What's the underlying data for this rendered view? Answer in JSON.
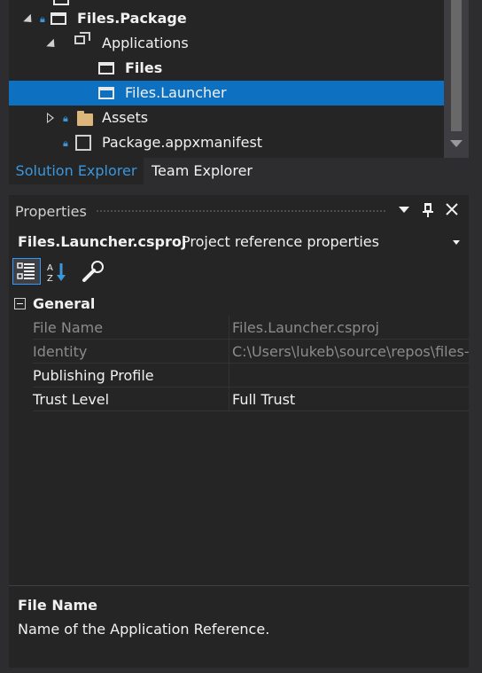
{
  "tree": {
    "items": [
      {
        "label": "Files.Package",
        "bold": true
      },
      {
        "label": "Applications",
        "bold": false
      },
      {
        "label": "Files",
        "bold": true
      },
      {
        "label": "Files.Launcher",
        "bold": false,
        "selected": true
      },
      {
        "label": "Assets",
        "bold": false
      },
      {
        "label": "Package.appxmanifest",
        "bold": false
      }
    ]
  },
  "tabs": {
    "solution_explorer": "Solution Explorer",
    "team_explorer": "Team Explorer"
  },
  "properties": {
    "title": "Properties",
    "object_name": "Files.Launcher.csproj",
    "object_type": "Project reference properties",
    "category": "General",
    "rows": [
      {
        "name": "File Name",
        "value": "Files.Launcher.csproj",
        "readonly": true
      },
      {
        "name": "Identity",
        "value": "C:\\Users\\lukeb\\source\\repos\\files-",
        "readonly": true
      },
      {
        "name": "Publishing Profile",
        "value": "",
        "readonly": false
      },
      {
        "name": "Trust Level",
        "value": "Full Trust",
        "readonly": false
      }
    ],
    "description_title": "File Name",
    "description_text": "Name of the Application Reference."
  },
  "colors": {
    "selection": "#0e70c0",
    "accent": "#3a96dd",
    "background": "#2d2d30",
    "panel": "#252526"
  }
}
